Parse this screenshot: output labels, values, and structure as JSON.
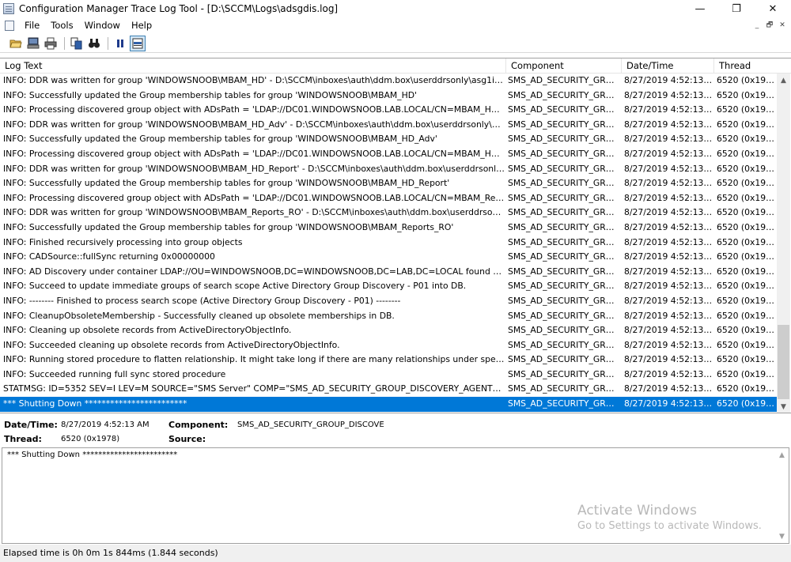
{
  "window": {
    "title": "Configuration Manager Trace Log Tool - [D:\\SCCM\\Logs\\adsgdis.log]",
    "minimize": "—",
    "maximize": "❐",
    "close": "✕"
  },
  "menu": {
    "items": [
      "File",
      "Tools",
      "Window",
      "Help"
    ],
    "mdi": [
      "_",
      "🗗",
      "✕"
    ]
  },
  "toolbar": {
    "icons": [
      "open-folder-icon",
      "print-preview-icon",
      "print-icon",
      "copy-icon",
      "find-icon",
      "pause-icon",
      "highlight-icon"
    ]
  },
  "list": {
    "columns": [
      "Log Text",
      "Component",
      "Date/Time",
      "Thread"
    ],
    "rows": [
      [
        "INFO: DDR was written for group 'WINDOWSNOOB\\MBAM_HD' - D:\\SCCM\\inboxes\\auth\\ddm.box\\userddrsonly\\asg1ifp...",
        "SMS_AD_SECURITY_GROUP",
        "8/27/2019 4:52:13 AM",
        "6520 (0x1978)"
      ],
      [
        "INFO: Successfully updated the Group membership tables for group 'WINDOWSNOOB\\MBAM_HD'",
        "SMS_AD_SECURITY_GROUP",
        "8/27/2019 4:52:13 AM",
        "6520 (0x1978)"
      ],
      [
        "INFO: Processing discovered group object with ADsPath = 'LDAP://DC01.WINDOWSNOOB.LAB.LOCAL/CN=MBAM_HD_...",
        "SMS_AD_SECURITY_GROUP",
        "8/27/2019 4:52:13 AM",
        "6520 (0x1978)"
      ],
      [
        "INFO: DDR was written for group 'WINDOWSNOOB\\MBAM_HD_Adv' - D:\\SCCM\\inboxes\\auth\\ddm.box\\userddrsonly\\as...",
        "SMS_AD_SECURITY_GROUP",
        "8/27/2019 4:52:13 AM",
        "6520 (0x1978)"
      ],
      [
        "INFO: Successfully updated the Group membership tables for group 'WINDOWSNOOB\\MBAM_HD_Adv'",
        "SMS_AD_SECURITY_GROUP",
        "8/27/2019 4:52:13 AM",
        "6520 (0x1978)"
      ],
      [
        "INFO: Processing discovered group object with ADsPath = 'LDAP://DC01.WINDOWSNOOB.LAB.LOCAL/CN=MBAM_HD_...",
        "SMS_AD_SECURITY_GROUP",
        "8/27/2019 4:52:13 AM",
        "6520 (0x1978)"
      ],
      [
        "INFO: DDR was written for group 'WINDOWSNOOB\\MBAM_HD_Report' - D:\\SCCM\\inboxes\\auth\\ddm.box\\userddrsonly...",
        "SMS_AD_SECURITY_GROUP",
        "8/27/2019 4:52:13 AM",
        "6520 (0x1978)"
      ],
      [
        "INFO: Successfully updated the Group membership tables for group 'WINDOWSNOOB\\MBAM_HD_Report'",
        "SMS_AD_SECURITY_GROUP",
        "8/27/2019 4:52:13 AM",
        "6520 (0x1978)"
      ],
      [
        "INFO: Processing discovered group object with ADsPath = 'LDAP://DC01.WINDOWSNOOB.LAB.LOCAL/CN=MBAM_Rep...",
        "SMS_AD_SECURITY_GROUP",
        "8/27/2019 4:52:13 AM",
        "6520 (0x1978)"
      ],
      [
        "INFO: DDR was written for group 'WINDOWSNOOB\\MBAM_Reports_RO' - D:\\SCCM\\inboxes\\auth\\ddm.box\\userddrsonl...",
        "SMS_AD_SECURITY_GROUP",
        "8/27/2019 4:52:13 AM",
        "6520 (0x1978)"
      ],
      [
        "INFO: Successfully updated the Group membership tables for group 'WINDOWSNOOB\\MBAM_Reports_RO'",
        "SMS_AD_SECURITY_GROUP",
        "8/27/2019 4:52:13 AM",
        "6520 (0x1978)"
      ],
      [
        "INFO: Finished recursively processing into group objects",
        "SMS_AD_SECURITY_GROUP",
        "8/27/2019 4:52:13 AM",
        "6520 (0x1978)"
      ],
      [
        "INFO: CADSource::fullSync returning 0x00000000",
        "SMS_AD_SECURITY_GROUP",
        "8/27/2019 4:52:13 AM",
        "6520 (0x1978)"
      ],
      [
        "INFO: AD Discovery under container LDAP://OU=WINDOWSNOOB,DC=WINDOWSNOOB,DC=LAB,DC=LOCAL found 5 o...",
        "SMS_AD_SECURITY_GROUP",
        "8/27/2019 4:52:13 AM",
        "6520 (0x1978)"
      ],
      [
        "INFO: Succeed to update immediate groups of search scope Active Directory Group Discovery - P01 into DB.",
        "SMS_AD_SECURITY_GROUP",
        "8/27/2019 4:52:13 AM",
        "6520 (0x1978)"
      ],
      [
        "INFO: -------- Finished to process search scope (Active Directory Group Discovery - P01) --------",
        "SMS_AD_SECURITY_GROUP",
        "8/27/2019 4:52:13 AM",
        "6520 (0x1978)"
      ],
      [
        "INFO: CleanupObsoleteMembership - Successfully cleaned up obsolete memberships in DB.",
        "SMS_AD_SECURITY_GROUP",
        "8/27/2019 4:52:13 AM",
        "6520 (0x1978)"
      ],
      [
        "INFO: Cleaning up obsolete records from ActiveDirectoryObjectInfo.",
        "SMS_AD_SECURITY_GROUP",
        "8/27/2019 4:52:13 AM",
        "6520 (0x1978)"
      ],
      [
        "INFO: Succeeded cleaning up obsolete records from ActiveDirectoryObjectInfo.",
        "SMS_AD_SECURITY_GROUP",
        "8/27/2019 4:52:13 AM",
        "6520 (0x1978)"
      ],
      [
        "INFO: Running stored procedure to flatten relationship. It might take long if there are many relationships under specified ...",
        "SMS_AD_SECURITY_GROUP",
        "8/27/2019 4:52:13 AM",
        "6520 (0x1978)"
      ],
      [
        "INFO: Succeeded running full sync stored procedure",
        "SMS_AD_SECURITY_GROUP",
        "8/27/2019 4:52:13 AM",
        "6520 (0x1978)"
      ],
      [
        "STATMSG: ID=5352 SEV=I LEV=M SOURCE=\"SMS Server\" COMP=\"SMS_AD_SECURITY_GROUP_DISCOVERY_AGENT\" SYS=...",
        "SMS_AD_SECURITY_GROUP",
        "8/27/2019 4:52:13 AM",
        "6520 (0x1978)"
      ],
      [
        "*** Shutting Down ************************",
        "SMS_AD_SECURITY_GROUP",
        "8/27/2019 4:52:13 AM",
        "6520 (0x1978)"
      ]
    ],
    "selected_index": 22
  },
  "details": {
    "datetime_label": "Date/Time:",
    "datetime_value": "8/27/2019 4:52:13 AM",
    "component_label": "Component:",
    "component_value": "SMS_AD_SECURITY_GROUP_DISCOVE",
    "thread_label": "Thread:",
    "thread_value": "6520 (0x1978)",
    "source_label": "Source:",
    "source_value": ""
  },
  "message": {
    "text": "*** Shutting Down ************************"
  },
  "watermark": {
    "line1": "Activate Windows",
    "line2": "Go to Settings to activate Windows."
  },
  "status": {
    "text": "Elapsed time is 0h 0m 1s 844ms (1.844 seconds)"
  },
  "colors": {
    "selection": "#0078d7"
  }
}
